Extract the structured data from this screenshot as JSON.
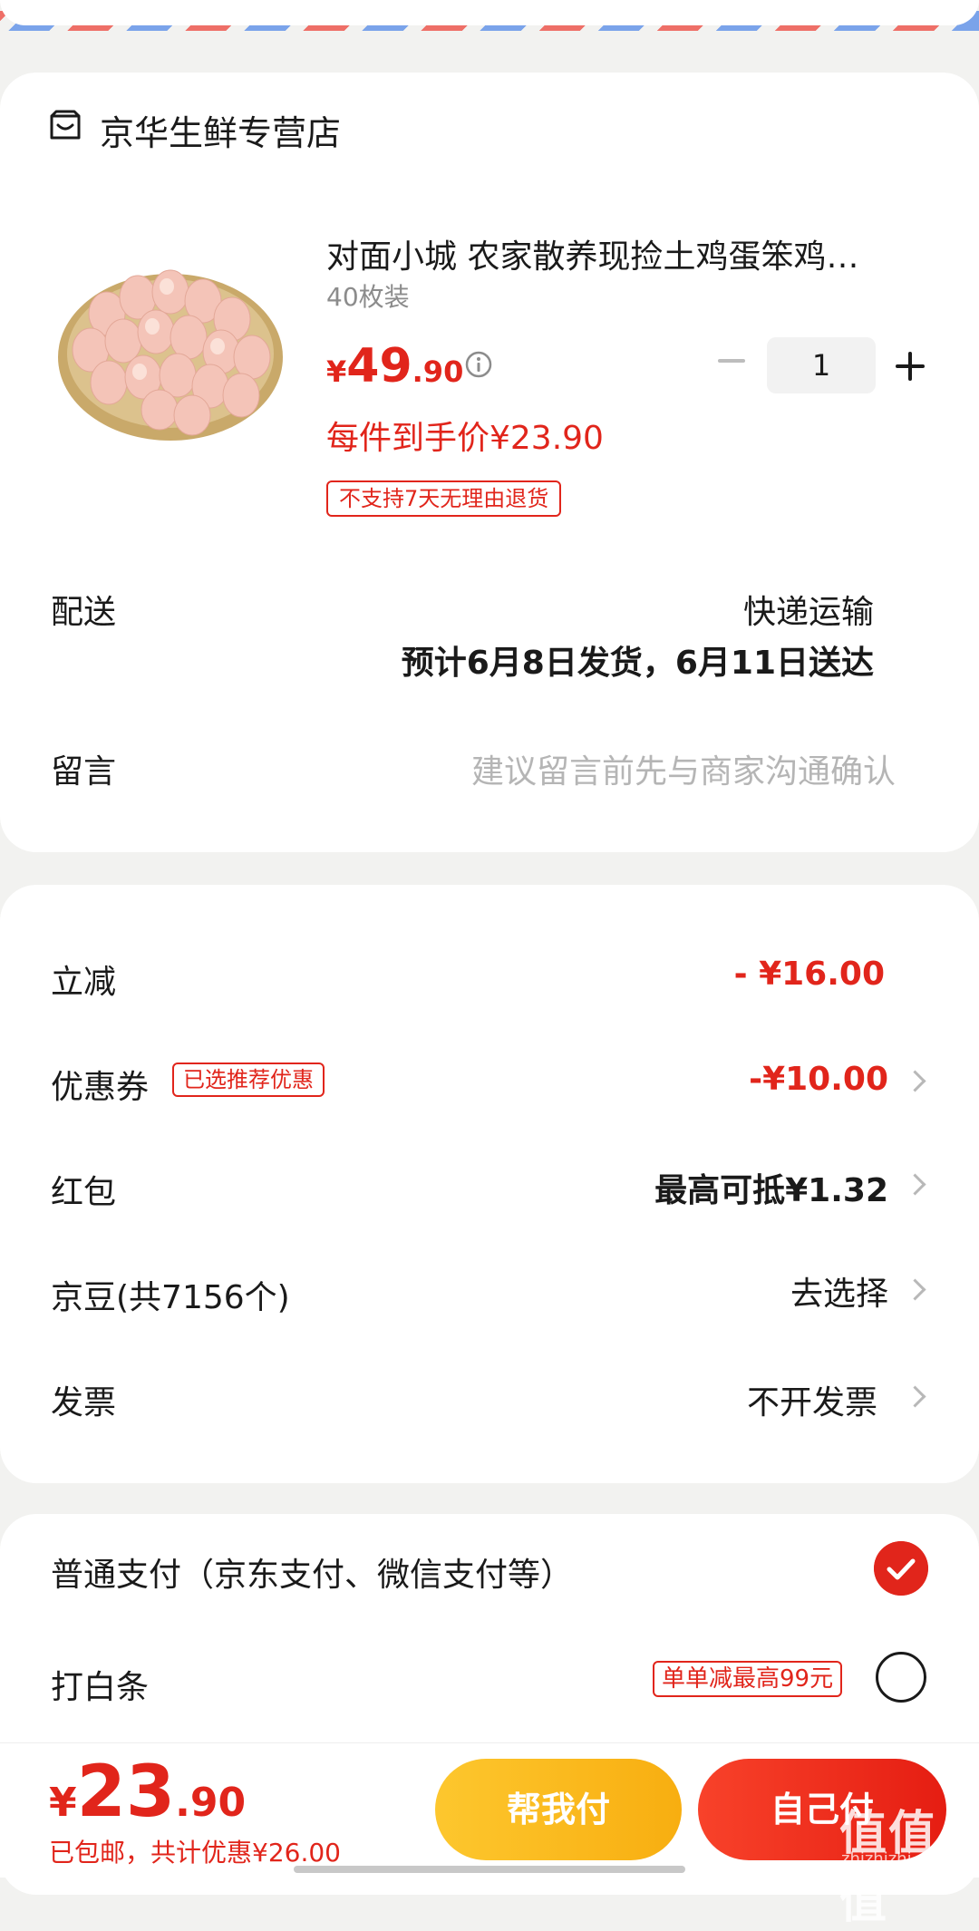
{
  "store": {
    "name": "京华生鲜专营店",
    "icon": "store-icon"
  },
  "product": {
    "title": "对面小城 农家散养现捡土鸡蛋笨鸡…",
    "spec": "40枚装",
    "price_symbol": "¥",
    "price_int": "49",
    "price_dec": ".90",
    "final_price": "每件到手价¥23.90",
    "return_tag": "不支持7天无理由退货",
    "quantity": "1",
    "image": "eggs-in-basket"
  },
  "delivery": {
    "label": "配送",
    "method": "快递运输",
    "eta": "预计6月8日发货，6月11日送达"
  },
  "remark": {
    "label": "留言",
    "placeholder": "建议留言前先与商家沟通确认"
  },
  "discounts": {
    "instant": {
      "label": "立减",
      "value": "- ¥16.00"
    },
    "coupon": {
      "label": "优惠券",
      "tag": "已选推荐优惠",
      "value": "-¥10.00"
    },
    "redpacket": {
      "label": "红包",
      "value": "最高可抵¥1.32"
    },
    "jingdou": {
      "label": "京豆(共7156个)",
      "value": "去选择"
    },
    "invoice": {
      "label": "发票",
      "value": "不开发票"
    }
  },
  "payment": {
    "normal": {
      "label": "普通支付（京东支付、微信支付等）",
      "selected": true
    },
    "baitiao": {
      "label": "打白条",
      "tag": "单单减最高99元",
      "selected": false
    }
  },
  "checkout": {
    "symbol": "¥",
    "total_int": "23",
    "total_dec": ".90",
    "summary": "已包邮，共计优惠¥26.00",
    "help_pay": "帮我付",
    "self_pay": "自己付"
  },
  "watermark": {
    "logo": "值值值",
    "text": "zhizhizhi.com"
  },
  "colors": {
    "accent": "#e1251b",
    "help_button": "#fbbb1f",
    "background": "#f2f2f0"
  }
}
